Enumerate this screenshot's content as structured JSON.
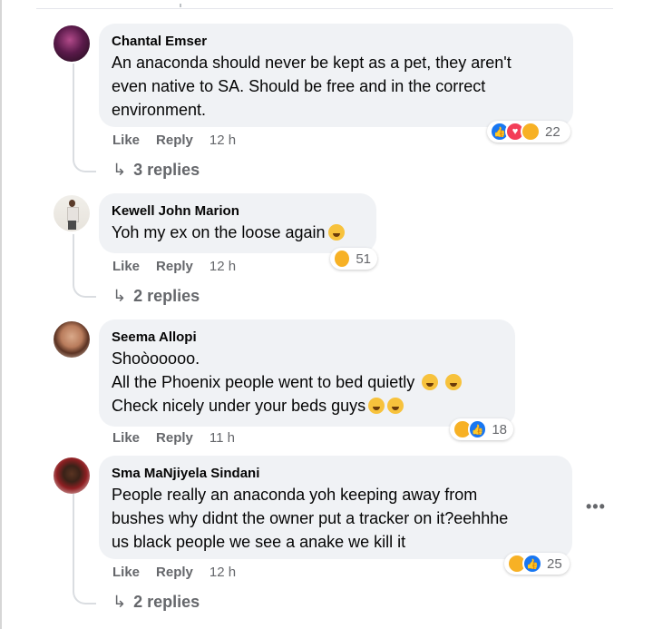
{
  "comments": [
    {
      "author": "Chantal Emser",
      "lines": [
        "An anaconda should never be kept as a pet, they aren't",
        "even native to SA. Should be free and in the correct",
        "environment."
      ],
      "like": "Like",
      "reply": "Reply",
      "time": "12 h",
      "reaction_count": "22",
      "reactions": [
        "like-reaction",
        "love-reaction",
        "haha-reaction"
      ],
      "replies": "3 replies"
    },
    {
      "author": "Kewell John Marion",
      "lines": [
        "Yoh my ex on the loose again"
      ],
      "like": "Like",
      "reply": "Reply",
      "time": "12 h",
      "reaction_count": "51",
      "reactions": [
        "haha-reaction"
      ],
      "replies": "2 replies"
    },
    {
      "author": "Seema Allopi",
      "lines": [
        "Shoòooooo.",
        "All the Phoenix people went to bed quietly",
        "Check nicely under your beds guys"
      ],
      "like": "Like",
      "reply": "Reply",
      "time": "11 h",
      "reaction_count": "18",
      "reactions": [
        "haha-reaction",
        "like-reaction"
      ],
      "replies": ""
    },
    {
      "author": "Sma MaNjiyela Sindani",
      "lines": [
        "People really an anaconda yoh keeping away from",
        "bushes why didnt the owner put a tracker on it?eehhhe",
        "us black people we see a anake we kill it"
      ],
      "like": "Like",
      "reply": "Reply",
      "time": "12 h",
      "reaction_count": "25",
      "reactions": [
        "haha-reaction",
        "like-reaction"
      ],
      "replies": "2 replies"
    }
  ],
  "more_label": "•••",
  "reply_arrow": "↳",
  "colors": {
    "bubble": "#f0f2f5",
    "meta": "#65676b",
    "like_blue": "#1877f2",
    "love_red": "#f33e58",
    "haha_yellow": "#f7b125"
  }
}
